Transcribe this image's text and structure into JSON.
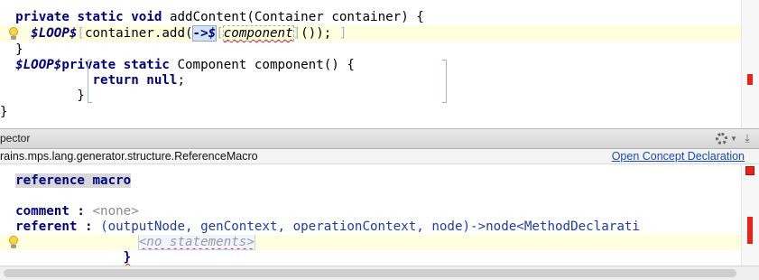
{
  "editor": {
    "line1": {
      "kw_private": "private",
      "kw_static": "static",
      "kw_void": "void",
      "rest": " addContent(Container container) {"
    },
    "line2": {
      "macro": "$LOOP$",
      "lb": "[",
      "call": "container.add(",
      "arrow": "->$",
      "lb2": "[",
      "ref": "component",
      "rb2": "]",
      "tail": "());",
      "rb": " ]"
    },
    "line3": {
      "brace": "}"
    },
    "line4": {
      "macro": "$LOOP$",
      "kw_private": "private",
      "kw_static": "static",
      "rest": " Component component() {"
    },
    "line5": {
      "kw_return": "return",
      "kw_null": "null",
      "semi": ";"
    },
    "line6": {
      "brace": "}"
    },
    "line7": {
      "brace": "}"
    }
  },
  "inspector": {
    "header_title": "pector",
    "concept_path": "rains.mps.lang.generator.structure.ReferenceMacro",
    "open_link": "Open Concept Declaration",
    "concept_alias": "reference macro",
    "comment_label": "comment",
    "colon": " : ",
    "comment_value": "<none>",
    "referent_label": "referent",
    "referent_value": "(outputNode, genContext, operationContext, node)->node<MethodDeclarati",
    "no_statements": "<no statements>",
    "closing_brace": "}"
  },
  "colors": {
    "keyword": "#000080",
    "highlight_line": "#ffffdf",
    "error_mark": "#e8241a",
    "link": "#1b49b5"
  },
  "icons": [
    "intention-bulb-icon",
    "gear-icon",
    "pin-icon",
    "error-stripe-marker"
  ]
}
